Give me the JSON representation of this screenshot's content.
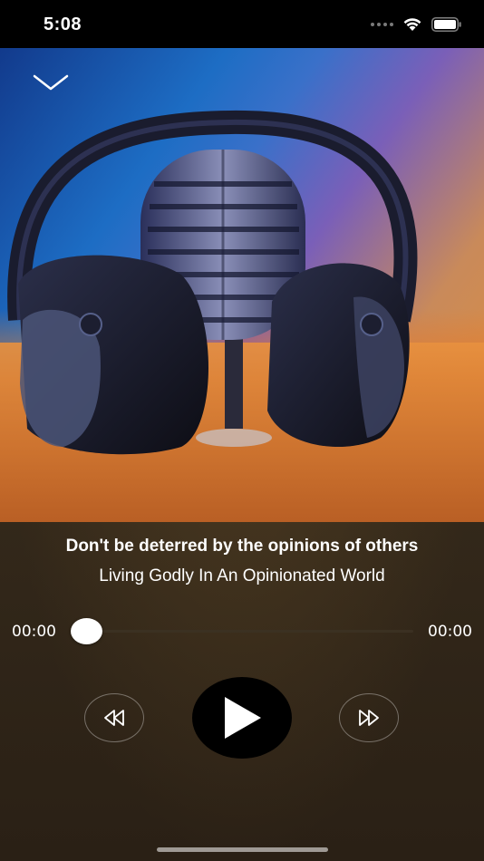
{
  "status_bar": {
    "time": "5:08",
    "icons": [
      "cellular-signal-icon",
      "wifi-icon",
      "battery-icon"
    ]
  },
  "header": {
    "collapse_icon": "chevron-down-icon"
  },
  "artwork": {
    "description_icon": "microphone-headphones-artwork"
  },
  "track": {
    "title": "Don't be deterred by the opinions of others",
    "subtitle": "Living Godly In An Opinionated World"
  },
  "progress": {
    "elapsed": "00:00",
    "total": "00:00",
    "fraction": 0.0
  },
  "controls": {
    "rewind_icon": "rewind-icon",
    "play_icon": "play-icon",
    "forward_icon": "fast-forward-icon"
  },
  "colors": {
    "background": "#3a2d1a",
    "accent": "#ffffff",
    "play_button": "#000000"
  }
}
